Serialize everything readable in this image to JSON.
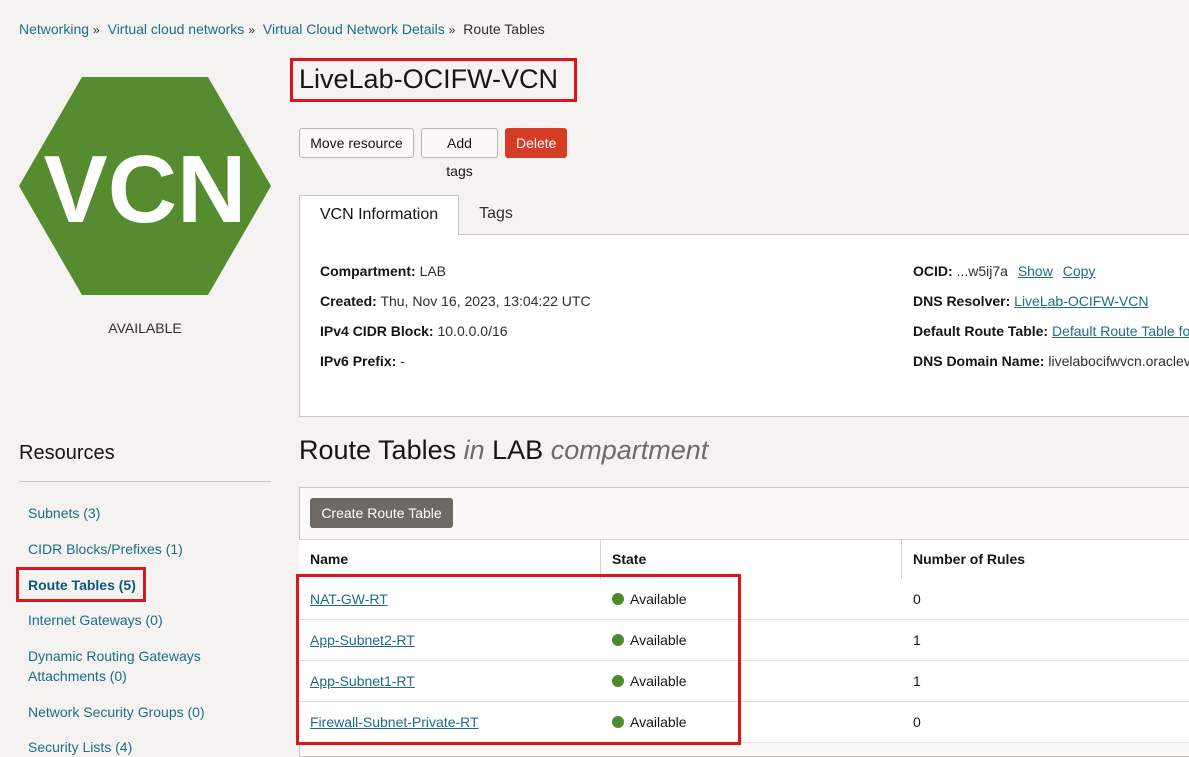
{
  "breadcrumb": {
    "items": [
      "Networking",
      "Virtual cloud networks",
      "Virtual Cloud Network Details"
    ],
    "current": "Route Tables",
    "separator": "»"
  },
  "logo": {
    "text": "VCN",
    "color": "#548c2f",
    "state": "AVAILABLE"
  },
  "title": "LiveLab-OCIFW-VCN",
  "actions": {
    "move": "Move resource",
    "add_tags": "Add tags",
    "delete": "Delete"
  },
  "tabs": {
    "info": "VCN Information",
    "tags": "Tags"
  },
  "info": {
    "compartment_label": "Compartment:",
    "compartment": "LAB",
    "created_label": "Created:",
    "created": "Thu, Nov 16, 2023, 13:04:22 UTC",
    "ipv4_label": "IPv4 CIDR Block:",
    "ipv4": "10.0.0.0/16",
    "ipv6_label": "IPv6 Prefix:",
    "ipv6": "-",
    "ocid_label": "OCID:",
    "ocid": "...w5ij7a",
    "ocid_show": "Show",
    "ocid_copy": "Copy",
    "dns_resolver_label": "DNS Resolver:",
    "dns_resolver": "LiveLab-OCIFW-VCN",
    "default_rt_label": "Default Route Table:",
    "default_rt": "Default Route Table fo",
    "dns_domain_label": "DNS Domain Name:",
    "dns_domain": "livelabocifwvcn.oraclev"
  },
  "resources": {
    "title": "Resources",
    "items": [
      "Subnets (3)",
      "CIDR Blocks/Prefixes (1)",
      "Route Tables (5)",
      "Internet Gateways (0)",
      "Dynamic Routing Gateways Attachments (0)",
      "Network Security Groups (0)",
      "Security Lists (4)"
    ]
  },
  "section": {
    "title": "Route Tables",
    "in": "in",
    "compartment": "LAB",
    "suffix": "compartment"
  },
  "create_button": "Create Route Table",
  "table": {
    "headers": [
      "Name",
      "State",
      "Number of Rules"
    ],
    "rows": [
      {
        "name": "NAT-GW-RT",
        "state": "Available",
        "rules": "0"
      },
      {
        "name": "App-Subnet2-RT",
        "state": "Available",
        "rules": "1"
      },
      {
        "name": "App-Subnet1-RT",
        "state": "Available",
        "rules": "1"
      },
      {
        "name": "Firewall-Subnet-Private-RT",
        "state": "Available",
        "rules": "0"
      }
    ]
  },
  "colors": {
    "accent_link": "#1f6b8a",
    "delete": "#d63b25",
    "available": "#4c8a2b",
    "highlight": "#d7191f"
  }
}
